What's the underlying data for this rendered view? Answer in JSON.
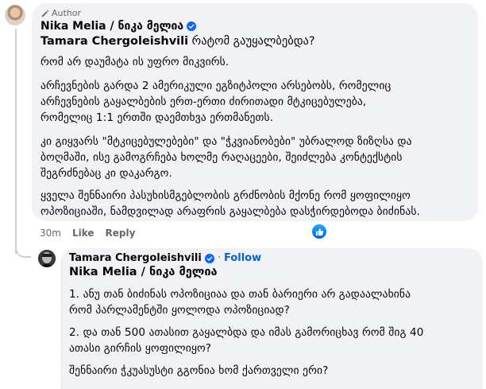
{
  "comment": {
    "author_label": "Author",
    "name": "Nika Melia / ნიკა მელია",
    "mention": "Tamara Chergoleishvili",
    "mention_rest": " რატომ გაუყალბებდა?",
    "paragraphs": [
      [
        "რომ არ დაუმატა ის უფრო მიკვირს."
      ],
      [
        "არჩევნების გარდა 2 ამერიკული ეგზიტპოლი არსებობს, რომელიც",
        "არჩევნების გაყალბების ერთ-ერთი ძირითადი მტკიცებულება,",
        "რომელიც 1:1 ერთში დაემთხვა ერთმანეთს."
      ],
      [
        "კი გიყვარს \"მტკიცებულებები\" და \"ჭკვიანობები\" უბრალოდ ზიზღსა და",
        "ბოღმაში, ისე გამოგრჩება ხოლმე რაღაცეები, შეიძლება კონტექსტის",
        "შეგრძნებაც კი დაკარგო."
      ],
      [
        "ყველა შენნაირი პასუხისმგებლობის გრძნობის მქონე რომ ყოფილიყო",
        "ოპოზიციაში, ნამდვილად არაფრის გაყალბება დასჭირდებოდა ბიძინას."
      ]
    ],
    "time": "30m",
    "like_label": "Like",
    "reply_label": "Reply"
  },
  "reply": {
    "name": "Tamara Chergoleishvili",
    "dot": "·",
    "follow_label": "Follow",
    "mention": "Nika Melia / ნიკა მელია",
    "paragraphs": [
      [
        "1. ანუ თან ბიძინას ოპოზიციაა და თან ბარიერი არ გადაალახინა",
        "რომ პარლამენტში ყოლოდა ოპოზიციად?"
      ],
      [
        "2. და თან 500 ათასით გაყალბდა და იმას გამორიცხავ რომ შიგ 40",
        "ათასი გირჩის ყოფილიყო?"
      ],
      [
        "შენნაირი ჭკუასუსტი გგონია ხომ ქართველი ერი?"
      ]
    ]
  },
  "colors": {
    "bubble": "#f0f2f5",
    "meta_text": "#65676b",
    "link_blue": "#0064d1",
    "verified_blue": "#0866ff"
  },
  "icons": [
    "pen-icon",
    "verified-badge-icon",
    "like-thumb-icon"
  ]
}
